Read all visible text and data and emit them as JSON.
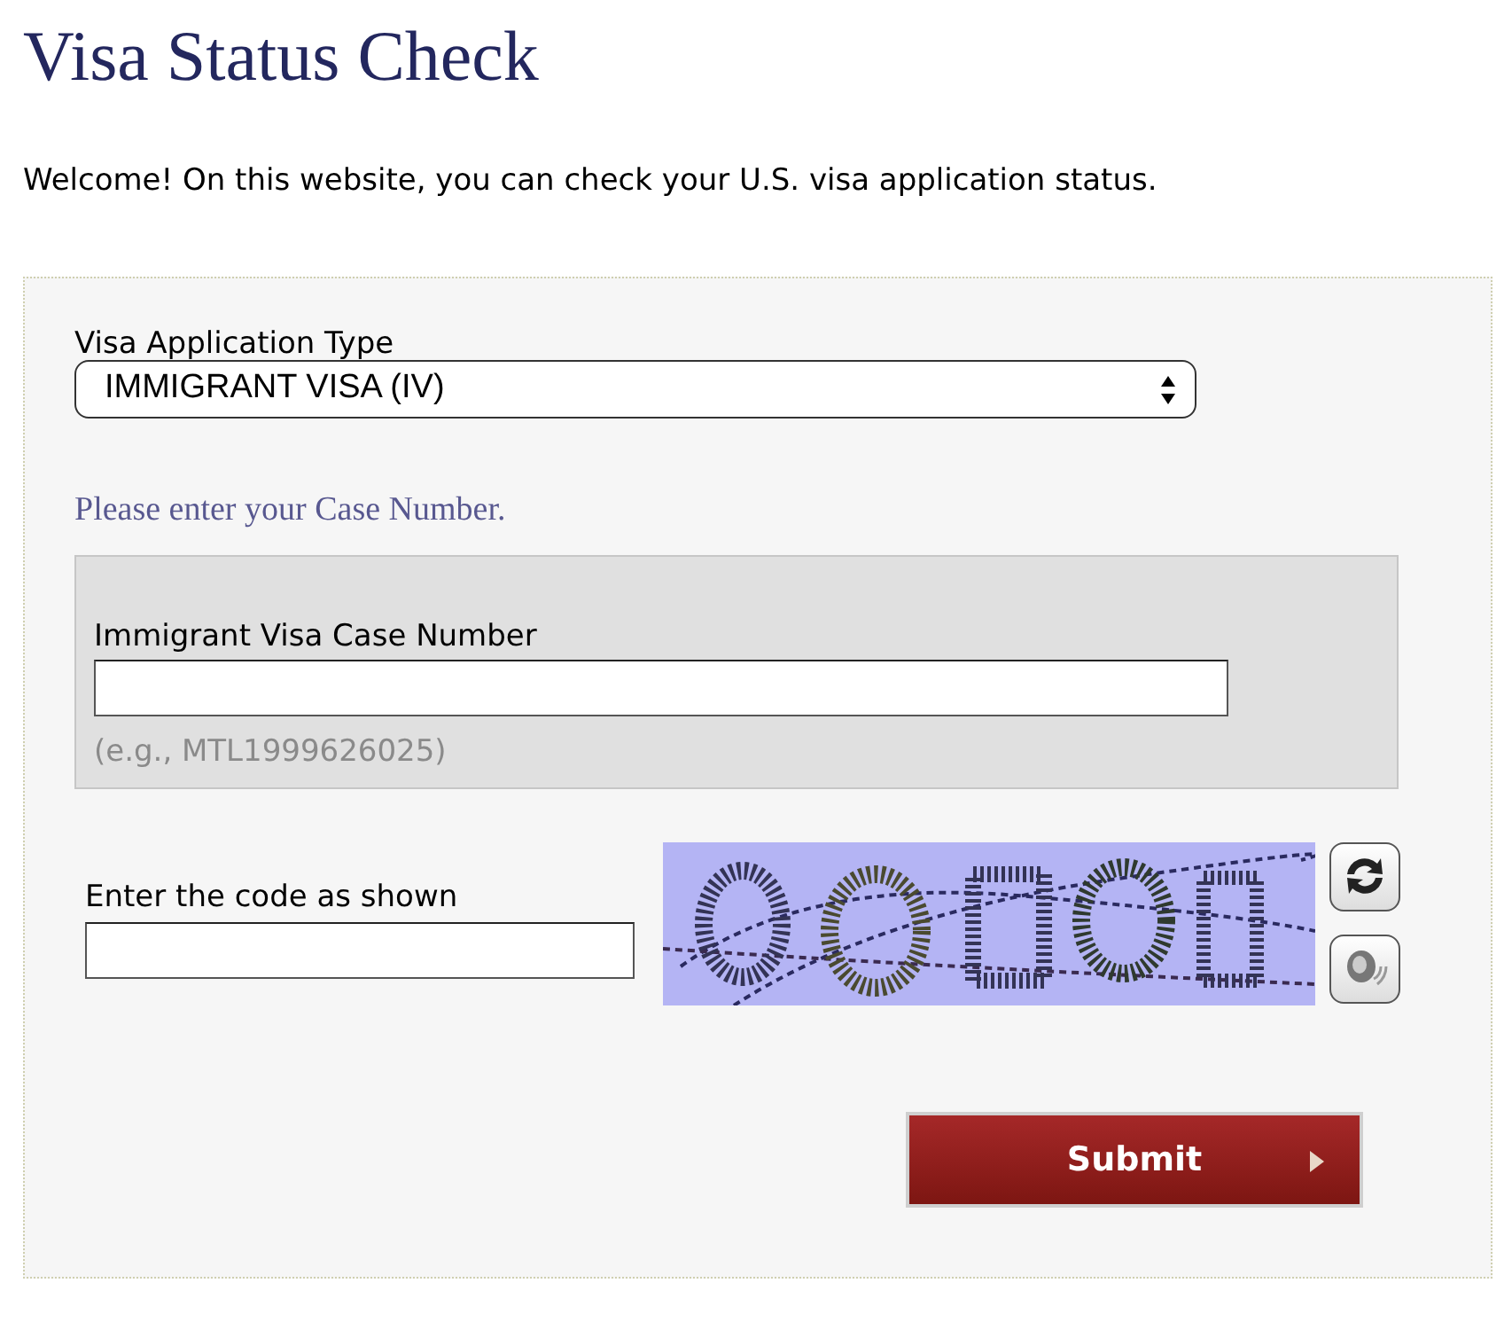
{
  "page": {
    "title": "Visa Status Check",
    "intro": "Welcome! On this website, you can check your U.S. visa application status."
  },
  "form": {
    "type_label": "Visa Application Type",
    "type_value": "IMMIGRANT VISA (IV)",
    "prompt": "Please enter your Case Number.",
    "case_label": "Immigrant Visa Case Number",
    "case_hint": "(e.g., MTL1999626025)",
    "code_label": "Enter the code as shown",
    "submit": "Submit"
  }
}
